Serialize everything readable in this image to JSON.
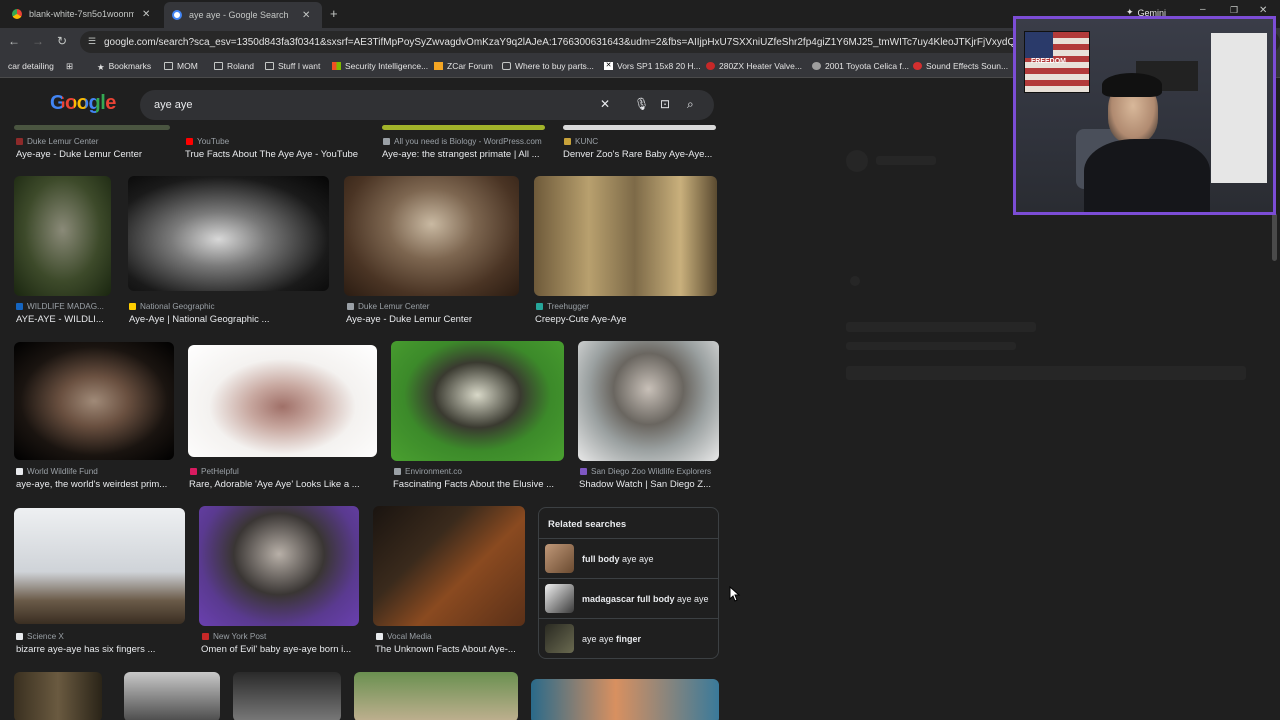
{
  "browser": {
    "tabs": [
      {
        "title": "blank-white-7sn5o1woonmklx",
        "favicon_color": "#ea4335"
      },
      {
        "title": "aye aye - Google Search",
        "favicon_color": "#4285f4"
      }
    ],
    "new_tab_symbol": "+",
    "gemini_label": "Gemini",
    "url": "google.com/search?sca_esv=1350d843fa3f0341&sxsrf=AE3TifMpPoySyZwvagdvOmKzaY9q2lAJeA:1766300631643&udm=2&fbs=AIIjpHxU7SXXniUZfeShr2fp4giZ1Y6MJ25_tmWITc7uy4KleoJTKjrFjVxydQWql2NcOhZVmrJB8",
    "bookmarks": [
      "car detailing",
      "Bookmarks",
      "MOM",
      "Roland",
      "Stuff I want",
      "Security Intelligence...",
      "ZCar Forum",
      "Where to buy parts...",
      "Vors SP1 15x8 20 H...",
      "280ZX Heater Valve...",
      "2001 Toyota Celica f...",
      "Sound Effects Soun..."
    ]
  },
  "search": {
    "logo": "Google",
    "query": "aye aye"
  },
  "results": {
    "row0": [
      {
        "source": "Duke Lemur Center",
        "title": "Aye-aye - Duke Lemur Center"
      },
      {
        "source": "YouTube",
        "title": "True Facts About The Aye Aye - YouTube"
      },
      {
        "source": "All you need is Biology - WordPress.com",
        "title": "Aye-aye: the strangest primate | All ..."
      },
      {
        "source": "KUNC",
        "title": "Denver Zoo's Rare Baby Aye-Aye..."
      }
    ],
    "row1": [
      {
        "source": "WILDLIFE MADAG...",
        "title": "AYE-AYE - WILDLI..."
      },
      {
        "source": "National Geographic",
        "title": "Aye-Aye | National Geographic ..."
      },
      {
        "source": "Duke Lemur Center",
        "title": "Aye-aye - Duke Lemur Center"
      },
      {
        "source": "Treehugger",
        "title": "Creepy-Cute Aye-Aye"
      }
    ],
    "row2": [
      {
        "source": "World Wildlife Fund",
        "title": "aye-aye, the world's weirdest prim..."
      },
      {
        "source": "PetHelpful",
        "title": "Rare, Adorable 'Aye Aye' Looks Like a ..."
      },
      {
        "source": "Environment.co",
        "title": "Fascinating Facts About the Elusive ..."
      },
      {
        "source": "San Diego Zoo Wildlife Explorers",
        "title": "Shadow Watch | San Diego Z..."
      }
    ],
    "row3": [
      {
        "source": "Science X",
        "title": "bizarre aye-aye has six fingers ..."
      },
      {
        "source": "New York Post",
        "title": "Omen of Evil' baby aye-aye born i..."
      },
      {
        "source": "Vocal Media",
        "title": "The Unknown Facts About Aye-..."
      }
    ]
  },
  "related": {
    "heading": "Related searches",
    "items": [
      {
        "bold": "full body",
        "rest": " aye aye"
      },
      {
        "bold": "madagascar full body",
        "rest": " aye aye"
      },
      {
        "pre": "aye aye ",
        "bold": "finger"
      }
    ]
  },
  "webcam": {
    "flag_text": "FREEDOM"
  }
}
